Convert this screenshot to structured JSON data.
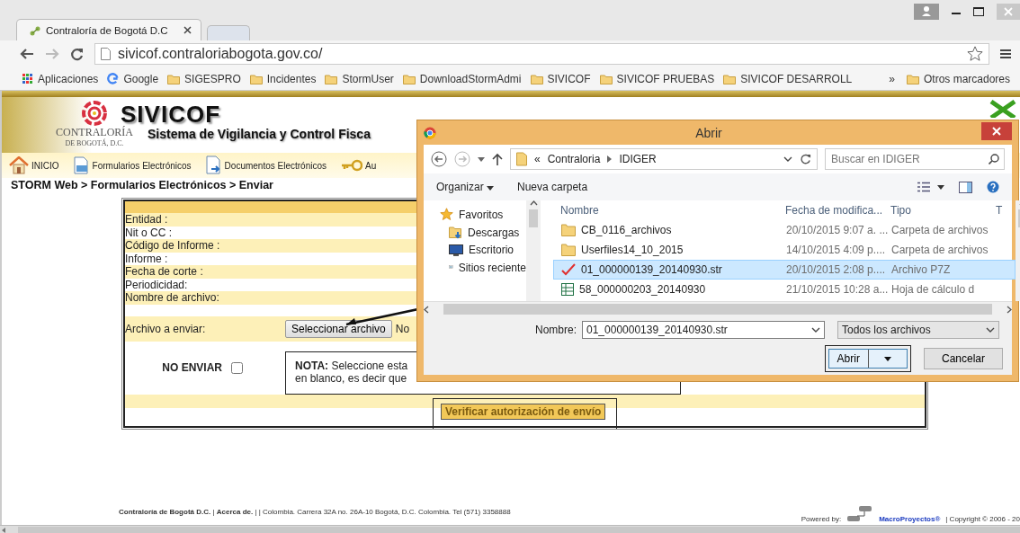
{
  "browser": {
    "tabs": [
      {
        "title": "Contraloría de Bogotá D.C",
        "selected": true
      },
      {
        "selected": false
      }
    ],
    "address": "sivicof.contraloriabogota.gov.co/",
    "bookmarks": [
      {
        "label": "Aplicaciones",
        "kind": "apps"
      },
      {
        "label": "Google",
        "kind": "google"
      },
      {
        "label": "SIGESPRO",
        "kind": "folder"
      },
      {
        "label": "Incidentes",
        "kind": "folder"
      },
      {
        "label": "StormUser",
        "kind": "folder"
      },
      {
        "label": "DownloadStormAdmi",
        "kind": "folder"
      },
      {
        "label": "SIVICOF",
        "kind": "folder"
      },
      {
        "label": "SIVICOF PRUEBAS",
        "kind": "folder"
      },
      {
        "label": "SIVICOF DESARROLL",
        "kind": "folder"
      }
    ],
    "overflow": "»",
    "other_bookmarks": "Otros marcadores"
  },
  "site": {
    "title": "SIVICOF",
    "subtitle": "Sistema de Vigilancia y Control Fisca",
    "logo_text": "CONTRALORÍA",
    "logo_subtext": "DE BOGOTÁ, D.C.",
    "nav": [
      {
        "label": "INICIO",
        "kind": "home"
      },
      {
        "label": "Formularios Electrónicos",
        "kind": "form"
      },
      {
        "label": "Documentos Electrónicos",
        "kind": "doc"
      },
      {
        "label": "Au",
        "kind": "key"
      }
    ],
    "breadcrumb": "STORM Web > Formularios Electrónicos > Enviar"
  },
  "form": {
    "fields": [
      "Entidad :",
      "Nit o CC :",
      "Código de Informe :",
      "Informe :",
      "Fecha de corte :",
      "Periodicidad:",
      "Nombre de archivo:"
    ],
    "file_label": "Archivo a enviar:",
    "file_button": "Seleccionar archivo",
    "file_status": "No",
    "no_enviar": {
      "label": "NO ENVIAR",
      "checked": false
    },
    "note_lines": [
      "**NOTA:** Seleccione esta",
      "en blanco, es decir que"
    ],
    "verify_button": "Verificar autorización de envío"
  },
  "dialog": {
    "title": "Abrir",
    "path_prefix": "«",
    "path": [
      "Contraloria",
      "IDIGER"
    ],
    "search_placeholder": "Buscar en IDIGER",
    "toolbar": [
      "Organizar",
      "Nueva carpeta"
    ],
    "nav": [
      {
        "label": "Favoritos",
        "kind": "star"
      },
      {
        "label": "Descargas",
        "kind": "download"
      },
      {
        "label": "Escritorio",
        "kind": "desktop"
      },
      {
        "label": "Sitios reciente",
        "kind": "recent"
      }
    ],
    "columns": [
      "Nombre",
      "Fecha de modifica...",
      "Tipo",
      "T"
    ],
    "files": [
      {
        "name": "CB_0116_archivos",
        "date": "20/10/2015 9:07 a. ...",
        "type": "Carpeta de archivos",
        "kind": "folder",
        "selected": false
      },
      {
        "name": "Userfiles14_10_2015",
        "date": "14/10/2015 4:09 p....",
        "type": "Carpeta de archivos",
        "kind": "folder",
        "selected": false
      },
      {
        "name": "01_000000139_20140930.str",
        "date": "20/10/2015 2:08 p....",
        "type": "Archivo P7Z",
        "kind": "signed",
        "selected": true
      },
      {
        "name": "58_000000203_20140930",
        "date": "21/10/2015 10:28 a...",
        "type": "Hoja de cálculo d",
        "kind": "sheet",
        "selected": false
      }
    ],
    "filename_label": "Nombre:",
    "filename": "01_000000139_20140930.str",
    "filter": "Todos los archivos",
    "open_button": "Abrir",
    "cancel_button": "Cancelar"
  },
  "footer": {
    "left": "**Contraloría de Bogotá D.C.** | **Acerca de.** | | Colombia. Carrera 32A no. 26A-10 Bogotá, D.C. Colombia. Tel (571) 3358888",
    "powered": "Powered by:",
    "link": "MacroProyectos®",
    "copyright": "| Copyright © 2006 - 20"
  }
}
